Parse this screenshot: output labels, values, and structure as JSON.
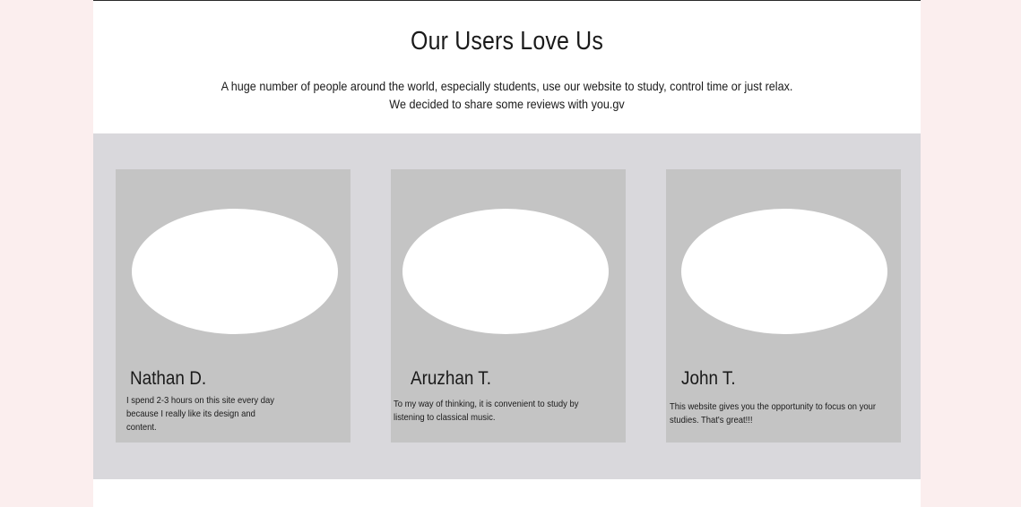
{
  "section": {
    "title": "Our Users Love Us",
    "intro": "A huge number of people around the world, especially students, use our website to study, control time or just relax. We decided to share some reviews with you.gv"
  },
  "reviews": [
    {
      "name": "Nathan D.",
      "text": "I spend 2-3 hours on this site every day because I really like its design and content."
    },
    {
      "name": "Aruzhan T.",
      "text": "To my way of thinking, it is convenient to study by listening to classical music."
    },
    {
      "name": "John T.",
      "text": "This website gives you the opportunity to focus on your studies. That's great!!!"
    }
  ],
  "colors": {
    "background": "#fbeeee",
    "band": "#d9d8dc",
    "card": "#c4c4c4",
    "avatar": "#ffffff"
  }
}
